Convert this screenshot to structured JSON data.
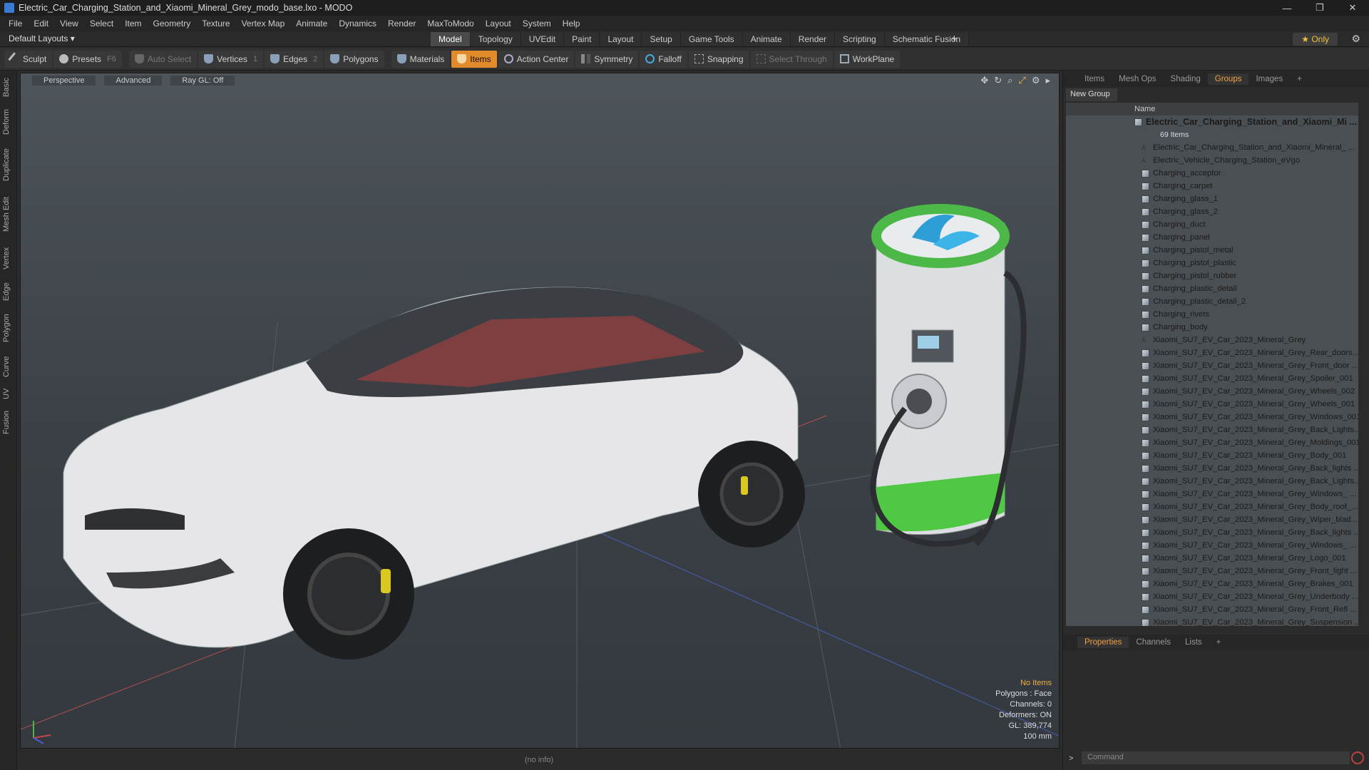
{
  "window": {
    "title": "Electric_Car_Charging_Station_and_Xiaomi_Mineral_Grey_modo_base.lxo - MODO",
    "controls": [
      "—",
      "❐",
      "✕"
    ]
  },
  "menu": [
    "File",
    "Edit",
    "View",
    "Select",
    "Item",
    "Geometry",
    "Texture",
    "Vertex Map",
    "Animate",
    "Dynamics",
    "Render",
    "MaxToModo",
    "Layout",
    "System",
    "Help"
  ],
  "layoutbar": {
    "layout_name": "Default Layouts ▾",
    "tabs": [
      "Model",
      "Topology",
      "UVEdit",
      "Paint",
      "Layout",
      "Setup",
      "Game Tools",
      "Animate",
      "Render",
      "Scripting",
      "Schematic Fusion"
    ],
    "active_tab": "Model",
    "only_label": "★  Only"
  },
  "toolbar": {
    "sculpt": "Sculpt",
    "presets": "Presets",
    "presets_key": "F6",
    "auto_select": "Auto Select",
    "vertices": "Vertices",
    "vertices_key": "1",
    "edges": "Edges",
    "edges_key": "2",
    "polygons": "Polygons",
    "materials": "Materials",
    "items": "Items",
    "action_center": "Action Center",
    "symmetry": "Symmetry",
    "falloff": "Falloff",
    "snapping": "Snapping",
    "select_through": "Select Through",
    "workplane": "WorkPlane"
  },
  "left_tabs": [
    "Basic",
    "Deform",
    "Duplicate",
    "Mesh Edit",
    "Vertex",
    "Edge",
    "Polygon",
    "Curve",
    "UV",
    "Fusion"
  ],
  "viewport": {
    "view": "Perspective",
    "shading": "Advanced",
    "raygl": "Ray GL: Off",
    "info": {
      "items": "No Items",
      "polygons": "Polygons : Face",
      "channels": "Channels: 0",
      "deformers": "Deformers: ON",
      "gl": "GL: 389,774",
      "scale": "100 mm"
    }
  },
  "status": "(no info)",
  "right_panel": {
    "tabs": [
      "Items",
      "Mesh Ops",
      "Shading",
      "Groups",
      "Images"
    ],
    "active_tab": "Groups",
    "new_group": "New Group",
    "column_name": "Name",
    "root": "Electric_Car_Charging_Station_and_Xiaomi_Mi ...",
    "root_count": "69 Items",
    "items": [
      {
        "name": "Electric_Car_Charging_Station_and_Xiaomi_Mineral_ ...",
        "type": "locator"
      },
      {
        "name": "Electric_Vehicle_Charging_Station_eVgo",
        "type": "locator"
      },
      {
        "name": "Charging_acceptor",
        "type": "mesh"
      },
      {
        "name": "Charging_carpet",
        "type": "mesh"
      },
      {
        "name": "Charging_glass_1",
        "type": "mesh"
      },
      {
        "name": "Charging_glass_2",
        "type": "mesh"
      },
      {
        "name": "Charging_duct",
        "type": "mesh"
      },
      {
        "name": "Charging_panel",
        "type": "mesh"
      },
      {
        "name": "Charging_pistol_metal",
        "type": "mesh"
      },
      {
        "name": "Charging_pistol_plastic",
        "type": "mesh"
      },
      {
        "name": "Charging_pistol_rubber",
        "type": "mesh"
      },
      {
        "name": "Charging_plastic_detail",
        "type": "mesh"
      },
      {
        "name": "Charging_plastic_detail_2",
        "type": "mesh"
      },
      {
        "name": "Charging_rivets",
        "type": "mesh"
      },
      {
        "name": "Charging_body",
        "type": "mesh"
      },
      {
        "name": "Xiaomi_SU7_EV_Car_2023_Mineral_Grey",
        "type": "locator"
      },
      {
        "name": "Xiaomi_SU7_EV_Car_2023_Mineral_Grey_Rear_doors...",
        "type": "mesh"
      },
      {
        "name": "Xiaomi_SU7_EV_Car_2023_Mineral_Grey_Front_door ...",
        "type": "mesh"
      },
      {
        "name": "Xiaomi_SU7_EV_Car_2023_Mineral_Grey_Spoiler_001",
        "type": "mesh"
      },
      {
        "name": "Xiaomi_SU7_EV_Car_2023_Mineral_Grey_Wheels_002",
        "type": "mesh"
      },
      {
        "name": "Xiaomi_SU7_EV_Car_2023_Mineral_Grey_Wheels_001",
        "type": "mesh"
      },
      {
        "name": "Xiaomi_SU7_EV_Car_2023_Mineral_Grey_Windows_001",
        "type": "mesh"
      },
      {
        "name": "Xiaomi_SU7_EV_Car_2023_Mineral_Grey_Back_Lights...",
        "type": "mesh"
      },
      {
        "name": "Xiaomi_SU7_EV_Car_2023_Mineral_Grey_Moldings_001",
        "type": "mesh"
      },
      {
        "name": "Xiaomi_SU7_EV_Car_2023_Mineral_Grey_Body_001",
        "type": "mesh"
      },
      {
        "name": "Xiaomi_SU7_EV_Car_2023_Mineral_Grey_Back_lights ...",
        "type": "mesh"
      },
      {
        "name": "Xiaomi_SU7_EV_Car_2023_Mineral_Grey_Back_Lights...",
        "type": "mesh"
      },
      {
        "name": "Xiaomi_SU7_EV_Car_2023_Mineral_Grey_Windows_ ...",
        "type": "mesh"
      },
      {
        "name": "Xiaomi_SU7_EV_Car_2023_Mineral_Grey_Body_roof_...",
        "type": "mesh"
      },
      {
        "name": "Xiaomi_SU7_EV_Car_2023_Mineral_Grey_Wiper_blad...",
        "type": "mesh"
      },
      {
        "name": "Xiaomi_SU7_EV_Car_2023_Mineral_Grey_Back_lights ...",
        "type": "mesh"
      },
      {
        "name": "Xiaomi_SU7_EV_Car_2023_Mineral_Grey_Windows_ ...",
        "type": "mesh"
      },
      {
        "name": "Xiaomi_SU7_EV_Car_2023_Mineral_Grey_Logo_001",
        "type": "mesh"
      },
      {
        "name": "Xiaomi_SU7_EV_Car_2023_Mineral_Grey_Front_light ...",
        "type": "mesh"
      },
      {
        "name": "Xiaomi_SU7_EV_Car_2023_Mineral_Grey_Brakes_001",
        "type": "mesh"
      },
      {
        "name": "Xiaomi_SU7_EV_Car_2023_Mineral_Grey_Underbody ...",
        "type": "mesh"
      },
      {
        "name": "Xiaomi_SU7_EV_Car_2023_Mineral_Grey_Front_Refl ...",
        "type": "mesh"
      },
      {
        "name": "Xiaomi_SU7_EV_Car_2023_Mineral_Grey_Suspension ...",
        "type": "mesh"
      }
    ],
    "bottom_tabs": [
      "Properties",
      "Channels",
      "Lists"
    ],
    "bottom_active": "Properties",
    "command_placeholder": "Command"
  },
  "colors": {
    "accent": "#e28b2b",
    "active_tab_text": "#f0a040",
    "only_star": "#f0c040"
  }
}
